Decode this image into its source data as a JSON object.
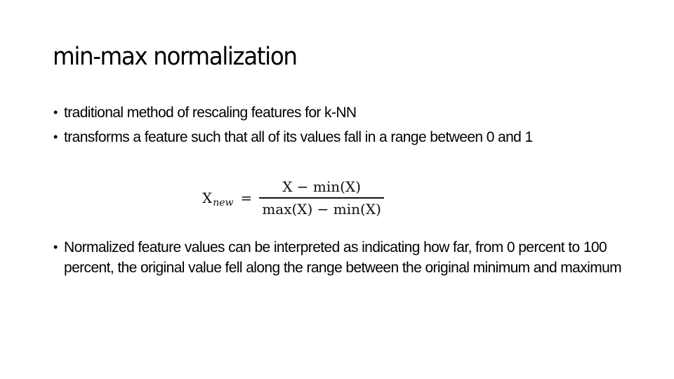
{
  "slide": {
    "title": "min-max normalization",
    "bullets_top": [
      {
        "marker": "•",
        "text": "traditional method of rescaling features for k-NN"
      },
      {
        "marker": "•",
        "text": "transforms a feature such that all of its values fall in a range between 0 and 1"
      }
    ],
    "formula": {
      "lhs": "X",
      "lhs_subscript": "new",
      "equals": "=",
      "numerator": "X − min(X)",
      "denominator": "max(X) − min(X)"
    },
    "bullets_bottom": [
      {
        "marker": "•",
        "text": "Normalized feature values can be interpreted as indicating how far, from 0 percent to 100 percent, the original value fell along the range between the original minimum and maximum"
      }
    ]
  }
}
